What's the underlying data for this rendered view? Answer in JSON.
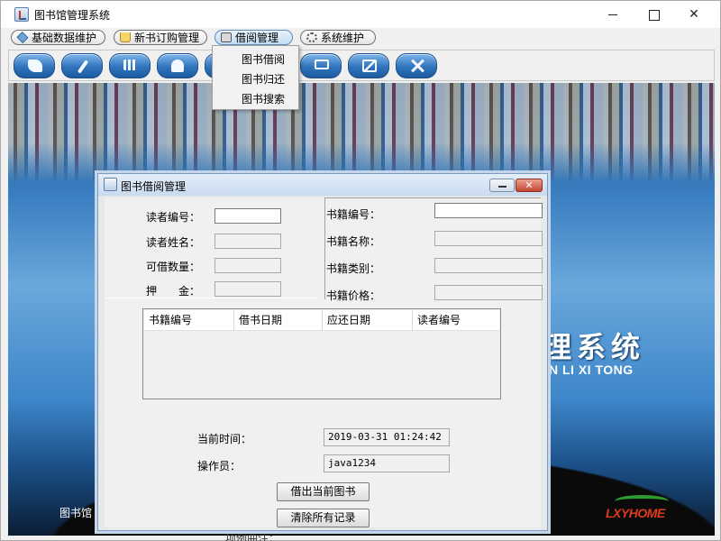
{
  "window": {
    "title": "图书馆管理系统"
  },
  "menubar": {
    "items": [
      {
        "label": "基础数据维护",
        "icon": "cube-icon"
      },
      {
        "label": "新书订购管理",
        "icon": "cart-icon"
      },
      {
        "label": "借阅管理",
        "icon": "lock-icon"
      },
      {
        "label": "系统维护",
        "icon": "gear-icon"
      }
    ]
  },
  "dropdown": {
    "items": [
      "图书借阅",
      "图书归还",
      "图书搜索"
    ]
  },
  "toolbar": {
    "buttons": [
      "book-icon",
      "pen-icon",
      "shelf-icon",
      "user-icon",
      "monitor-icon",
      "chart-icon",
      "tools-icon"
    ]
  },
  "splash": {
    "title": "理系统",
    "subtitle": "N LI XI TONG",
    "footer": "图书馆",
    "logo_text": "LXYHOME",
    "bottom_caption": "项例曲注："
  },
  "dialog": {
    "title": "图书借阅管理",
    "reader": {
      "id_label": "读者编号：",
      "id_value": "",
      "name_label": "读者姓名：",
      "name_value": "",
      "quota_label": "可借数量：",
      "quota_value": "",
      "deposit_label": "押　　金：",
      "deposit_value": ""
    },
    "book": {
      "id_label": "书籍编号：",
      "id_value": "",
      "name_label": "书籍名称：",
      "name_value": "",
      "category_label": "书籍类别：",
      "category_value": "",
      "price_label": "书籍价格：",
      "price_value": ""
    },
    "table": {
      "columns": [
        "书籍编号",
        "借书日期",
        "应还日期",
        "读者编号"
      ],
      "rows": []
    },
    "current_time_label": "当前时间：",
    "current_time_value": "2019-03-31 01:24:42",
    "operator_label": "操作员：",
    "operator_value": "java1234",
    "borrow_button": "借出当前图书",
    "clear_button": "清除所有记录"
  },
  "colors": {
    "toolbar_button": "#2f74bd",
    "dialog_border": "#7e9bc0",
    "close_button": "#c3472f"
  }
}
